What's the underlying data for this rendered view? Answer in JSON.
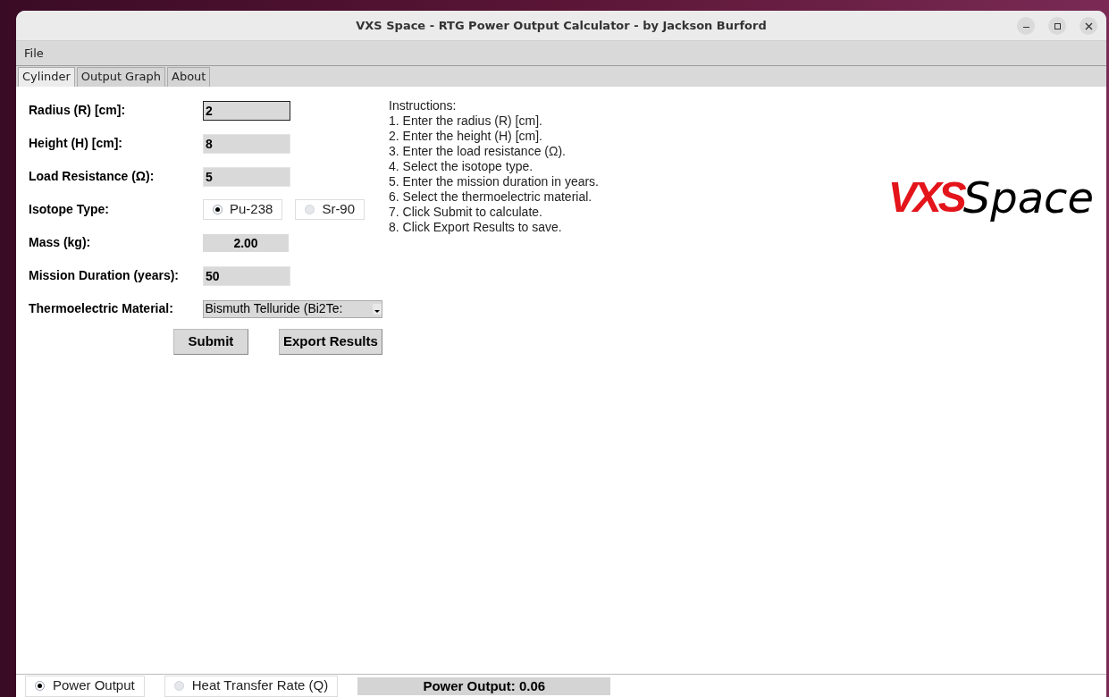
{
  "window": {
    "title": "VXS Space - RTG Power Output Calculator - by Jackson Burford"
  },
  "menu": [
    "File"
  ],
  "tabs": [
    {
      "label": "Cylinder",
      "selected": true
    },
    {
      "label": "Output Graph",
      "selected": false
    },
    {
      "label": "About",
      "selected": false
    }
  ],
  "form": [
    {
      "kind": "text",
      "label": "Radius (R) [cm]:",
      "value": "2",
      "focused": true
    },
    {
      "kind": "text",
      "label": "Height (H) [cm]:",
      "value": "8",
      "focused": false
    },
    {
      "kind": "text",
      "label": "Load Resistance (Ω):",
      "value": "5",
      "focused": false
    },
    {
      "kind": "radio",
      "label": "Isotope Type:",
      "options": [
        {
          "label": "Pu-238",
          "selected": true
        },
        {
          "label": "Sr-90",
          "selected": false
        }
      ]
    },
    {
      "kind": "readout",
      "label": "Mass (kg):",
      "value": "2.00"
    },
    {
      "kind": "text",
      "label": "Mission Duration (years):",
      "value": "50",
      "focused": false
    },
    {
      "kind": "dropdown",
      "label": "Thermoelectric Material:",
      "value": "Bismuth Telluride (Bi2Te:"
    }
  ],
  "buttons": [
    "Submit",
    "Export Results"
  ],
  "instructions": [
    "Instructions:",
    "1. Enter the radius (R) [cm].",
    "2. Enter the height (H) [cm].",
    "3. Enter the load resistance (Ω).",
    "4. Select the isotope type.",
    "5. Enter the mission duration in years.",
    "6. Select the thermoelectric material.",
    "7. Click Submit to calculate.",
    "8. Click Export Results to save."
  ],
  "logo": {
    "mark": "VXS",
    "word": "Space"
  },
  "status_bar": {
    "modes": [
      {
        "label": "Power Output",
        "selected": true
      },
      {
        "label": "Heat Transfer Rate (Q)",
        "selected": false
      }
    ],
    "readout": "Power Output: 0.06"
  }
}
